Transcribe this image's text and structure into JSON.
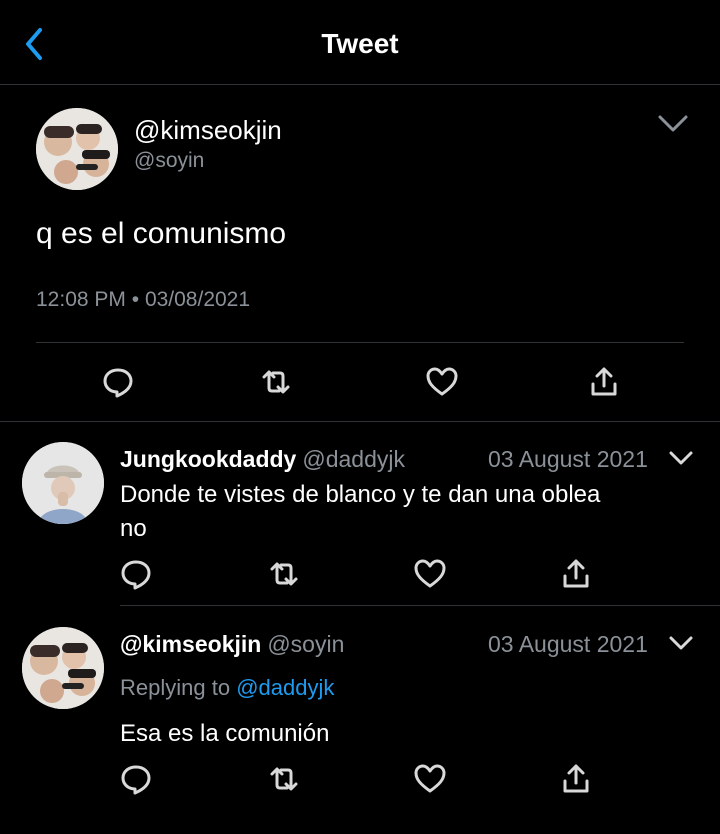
{
  "header": {
    "title": "Tweet"
  },
  "tweet": {
    "display_name": "@kimseokjin",
    "username": "@soyin",
    "text": "q es el comunismo",
    "time": "12:08 PM",
    "separator": "•",
    "date": "03/08/2021"
  },
  "replies": [
    {
      "display_name": "Jungkookdaddy",
      "username": "@daddyjk",
      "date": "03 August 2021",
      "text_line1": "Donde te vistes de blanco y te dan una oblea",
      "text_line2": "no"
    },
    {
      "display_name": "@kimseokjin",
      "username": "@soyin",
      "date": "03 August 2021",
      "replying_label": "Replying to",
      "replying_to": "@daddyjk",
      "text": "Esa es la comunión"
    }
  ],
  "icons": {
    "back": "chevron-left-icon",
    "more": "chevron-down-icon",
    "reply": "reply-icon",
    "retweet": "retweet-icon",
    "like": "heart-icon",
    "share": "share-icon"
  },
  "colors": {
    "accent": "#1d9bf0",
    "background": "#000000",
    "muted": "#8b9198",
    "text": "#ffffff"
  }
}
